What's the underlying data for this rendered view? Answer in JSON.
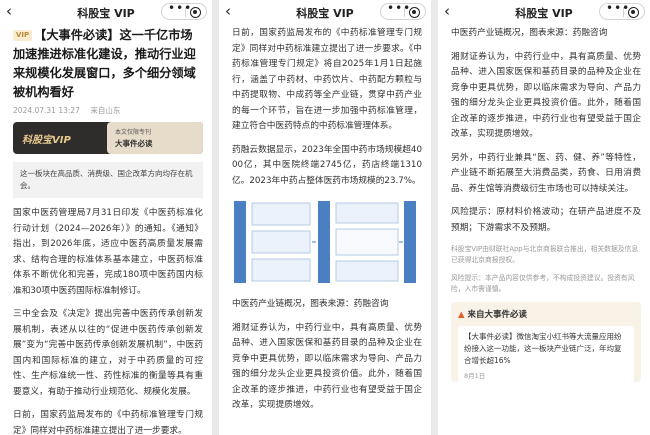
{
  "app": {
    "title": "科股宝 VIP"
  },
  "icons": {
    "back": "back-icon",
    "more": "more-icon",
    "target": "target-icon",
    "flame": "flame-icon"
  },
  "colors": {
    "vip_gold": "#b88a3c",
    "banner_dark": "#2f2d2b"
  },
  "panel1": {
    "vip_badge": "VIP",
    "headline": "【大事件必读】这一千亿市场加速推进标准化建设，推动行业迎来规模化发展窗口，多个细分领域被机构看好",
    "date": "2024.07.31 13:27",
    "source": "来自山东",
    "banner_logo": "科股宝VIP",
    "banner_sub1": "本文仅限专刊",
    "banner_sub2": "大事件必读",
    "quote": "这一板块在高品质、消费级、国企改革方向均存在机会。",
    "paragraphs": [
      "国家中医药管理局7月31日印发《中医药标准化行动计划（2024—2026年）》的通知。《通知》指出，到2026年底，适应中医药高质量发展需求、结构合理的标准体系基本建立，中医药标准体系不断优化和完善，完成180项中医药国内标准和30项中医药国际标准制修订。",
      "三中全会及《决定》提出完善中医药传承创新发展机制，表述从以往的“促进中医药传承创新发展”变为“完善中医药传承创新发展机制”，中医药国内和国际标准的建立，对于中药质量的可控性、生产标准统一性、药性标准的衡量等具有重要意义，有助于推动行业规范化、规模化发展。",
      "日前，国家药监局发布的《中药标准管理专门规定》同样对中药标准建立提出了进一步要求。"
    ]
  },
  "panel2": {
    "paragraphs": [
      "日前，国家药监局发布的《中药标准管理专门规定》同样对中药标准建立提出了进一步要求。《中药标准管理专门规定》将自2025年1月1日起施行，涵盖了中药材、中药饮片、中药配方颗粒与中药提取物、中成药等全产业链，贯穿中药产业的每一个环节，旨在进一步加强中药标准管理，建立符合中医药特点的中药标准管理体系。",
      "药融云数据显示，2023年全国中药市场规模超4000亿，其中医院终端2745亿，药店终端1310亿。2023年中药占整体医药市场规模的23.7%。"
    ],
    "figure_caption": "中医药产业链概况，图表来源：药融咨询",
    "paragraphs_after": [
      "湘财证券认为，中药行业中，具有高质量、优势品种、进入国家医保和基药目录的品种及企业在竞争中更具优势，即以临床需求为导向、产品力强的细分龙头企业更具投资价值。此外，随着国企改革的逐步推进，中药行业也有望受益于国企改革，实现提质增效。"
    ]
  },
  "panel3": {
    "paragraphs": [
      "中医药产业链概况，图表来源：药融咨询",
      "湘财证券认为，中药行业中，具有高质量、优势品种、进入国家医保和基药目录的品种及企业在竞争中更具优势，即以临床需求为导向、产品力强的细分龙头企业更具投资价值。此外，随着国企改革的逐步推进，中药行业也有望受益于国企改革，实现提质增效。",
      "另外，中药行业兼具“医、药、健、养”等特性，产业链不断拓展至大消费品类，药食、日用消费品、养生馆等消费级衍生市场也可以持续关注。",
      "风险提示：原材料价格波动；在研产品进度不及预期；下游需求不及预期。"
    ],
    "disclaimer1": "科股宝VIP由财联社App与北京商报联合推出，相关数据及信息已获得北京商报授权。",
    "disclaimer2": "风险提示：本产品内容仅供参考，不构成投资建议。投资有风险，入市需谨慎。",
    "related_header": "来自大事件必读",
    "related_item": "【大事件必读】微信淘宝小红书等大流量应用纷纷接入这一功能，这一板块产业链广泛，年均复合增长超16%",
    "related_date": "8月1日"
  }
}
